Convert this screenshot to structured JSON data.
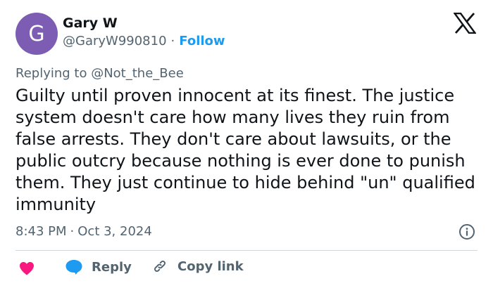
{
  "author": {
    "avatar_letter": "G",
    "avatar_color": "#7d5cb4",
    "display_name": "Gary W",
    "handle": "@GaryW990810",
    "separator": "·",
    "follow_label": "Follow"
  },
  "brand_icon": "x-logo-icon",
  "replying_to": "Replying to @Not_the_Bee",
  "tweet_text": "Guilty until proven innocent at its finest. The justice system doesn't care how many lives they ruin from false arrests. They don't care about lawsuits, or the public outcry because nothing is ever done to punish them. They just continue to hide behind \"un\" qualified immunity",
  "meta": {
    "time": "8:43 PM",
    "separator": "·",
    "date": "Oct 3, 2024"
  },
  "actions": {
    "like_icon": "heart-icon",
    "reply_label": "Reply",
    "copy_link_label": "Copy link"
  },
  "colors": {
    "accent": "#1d9bf0",
    "like": "#f91880",
    "muted_text": "#536471",
    "divider": "#cfd9de"
  }
}
